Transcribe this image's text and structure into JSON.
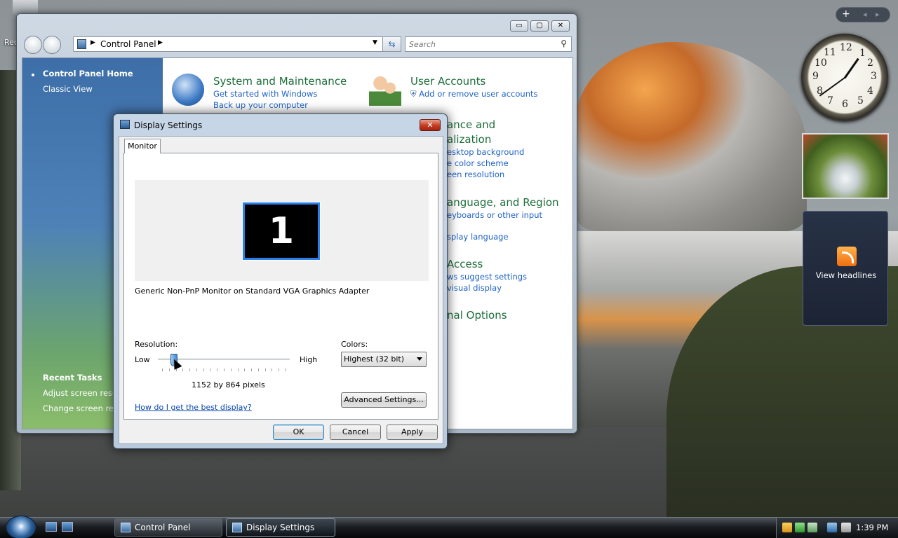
{
  "desktop": {
    "recycle_label": "Rec",
    "clock_numbers": [
      "12",
      "1",
      "2",
      "3",
      "4",
      "5",
      "6",
      "7",
      "8",
      "9",
      "10",
      "11"
    ],
    "feed_label": "View headlines",
    "gadget_controls": [
      "+",
      "◂",
      "▸"
    ]
  },
  "control_panel": {
    "window_buttons": [
      "▭",
      "▢",
      "✕"
    ],
    "address_text": "Control Panel",
    "search_placeholder": "Search",
    "sidebar": {
      "home": "Control Panel Home",
      "classic": "Classic View",
      "recent_tasks_title": "Recent Tasks",
      "recent_tasks": [
        "Adjust screen resolu",
        "Change screen reac"
      ]
    },
    "categories": [
      {
        "title": "System and Maintenance",
        "links": [
          "Get started with Windows",
          "Back up your computer"
        ]
      },
      {
        "title": "User Accounts",
        "links": [
          "Add or remove user accounts"
        ]
      },
      {
        "title_lines": [
          "ance and",
          "alization"
        ],
        "links": [
          "esktop background",
          "e color scheme",
          "een resolution"
        ]
      },
      {
        "title": "anguage, and Region",
        "links": [
          "eyboards or other input",
          "splay language"
        ]
      },
      {
        "title": "Access",
        "links": [
          "ws suggest settings",
          "visual display"
        ]
      },
      {
        "title": "nal Options",
        "links": []
      }
    ]
  },
  "dialog": {
    "title": "Display Settings",
    "close": "✕",
    "tab": "Monitor",
    "monitor_number": "1",
    "monitor_desc": "Generic Non-PnP Monitor on Standard VGA Graphics Adapter",
    "resolution_label": "Resolution:",
    "low": "Low",
    "high": "High",
    "resolution_value": "1152 by 864 pixels",
    "resolution_slider_fraction": 0.1,
    "colors_label": "Colors:",
    "colors_value": "Highest (32 bit)",
    "help_link": "How do I get the best display?",
    "advanced_button": "Advanced Settings...",
    "ok": "OK",
    "cancel": "Cancel",
    "apply": "Apply"
  },
  "taskbar": {
    "tasks": [
      "Control Panel",
      "Display Settings"
    ],
    "time": "1:39 PM"
  }
}
